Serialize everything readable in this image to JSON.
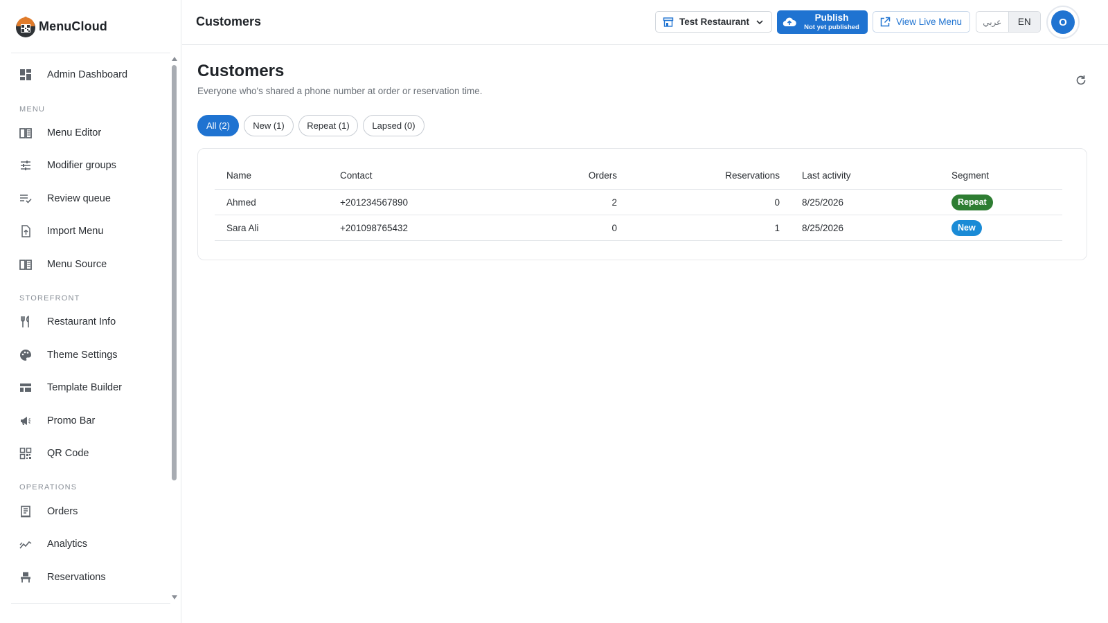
{
  "brand": {
    "name": "MenuCloud"
  },
  "sidebar": {
    "items": [
      {
        "key": "admin-dashboard",
        "label": "Admin Dashboard",
        "icon": "dashboard-icon"
      },
      {
        "key": "menu-editor",
        "label": "Menu Editor",
        "icon": "book-icon"
      },
      {
        "key": "modifier-groups",
        "label": "Modifier groups",
        "icon": "sliders-icon"
      },
      {
        "key": "review-queue",
        "label": "Review queue",
        "icon": "checklist-icon"
      },
      {
        "key": "import-menu",
        "label": "Import Menu",
        "icon": "file-upload-icon"
      },
      {
        "key": "menu-source",
        "label": "Menu Source",
        "icon": "book-icon"
      },
      {
        "key": "restaurant-info",
        "label": "Restaurant Info",
        "icon": "utensils-icon"
      },
      {
        "key": "theme-settings",
        "label": "Theme Settings",
        "icon": "palette-icon"
      },
      {
        "key": "template-builder",
        "label": "Template Builder",
        "icon": "layout-icon"
      },
      {
        "key": "promo-bar",
        "label": "Promo Bar",
        "icon": "megaphone-icon"
      },
      {
        "key": "qr-code",
        "label": "QR Code",
        "icon": "qr-code-icon"
      },
      {
        "key": "orders",
        "label": "Orders",
        "icon": "receipt-icon"
      },
      {
        "key": "analytics",
        "label": "Analytics",
        "icon": "trend-icon"
      },
      {
        "key": "reservations",
        "label": "Reservations",
        "icon": "chair-icon"
      }
    ],
    "sections": {
      "menu": "MENU",
      "storefront": "STOREFRONT",
      "operations": "OPERATIONS"
    }
  },
  "header": {
    "title": "Customers",
    "restaurant_select": "Test Restaurant",
    "publish_label": "Publish",
    "publish_sub": "Not yet published",
    "view_live_label": "View Live Menu",
    "lang_ar": "عربي",
    "lang_en": "EN",
    "avatar_initial": "O"
  },
  "main": {
    "title": "Customers",
    "subtitle": "Everyone who's shared a phone number at order or reservation time.",
    "filters": [
      {
        "label": "All (2)",
        "active": true
      },
      {
        "label": "New (1)",
        "active": false
      },
      {
        "label": "Repeat (1)",
        "active": false
      },
      {
        "label": "Lapsed (0)",
        "active": false
      }
    ],
    "table": {
      "columns": {
        "name": "Name",
        "contact": "Contact",
        "orders": "Orders",
        "reservations": "Reservations",
        "last_activity": "Last activity",
        "segment": "Segment"
      },
      "rows": [
        {
          "name": "Ahmed",
          "contact": "+201234567890",
          "orders": "2",
          "reservations": "0",
          "last_activity": "8/25/2026",
          "segment": "Repeat",
          "segment_color": "#2e7d32"
        },
        {
          "name": "Sara Ali",
          "contact": "+201098765432",
          "orders": "0",
          "reservations": "1",
          "last_activity": "8/25/2026",
          "segment": "New",
          "segment_color": "#1a8bd6"
        }
      ]
    }
  },
  "colors": {
    "accent": "#1f73d1",
    "repeat": "#2e7d32",
    "new": "#1a8bd6"
  }
}
